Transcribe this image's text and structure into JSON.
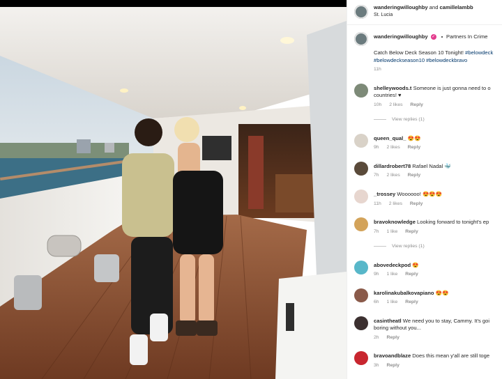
{
  "header": {
    "username": "wanderingwilloughby",
    "conjunction": "and",
    "collaborator": "camillelambb",
    "location": "St. Lucia"
  },
  "caption": {
    "username": "wanderingwilloughby",
    "label": "Partners In Crime",
    "line1_text": "Catch Below Deck Season 10 Tonight! ",
    "line1_tag": "#belowdeck",
    "line2": "#belowdeckseason10 #belowdeckbravo",
    "time": "11h"
  },
  "comments": [
    {
      "username": "shelleywoods.t",
      "text": "Someone is just gonna need to o",
      "text2": "countries! ♥",
      "time": "10h",
      "likes": "2 likes",
      "reply": "Reply",
      "view_replies": "View replies (1)"
    },
    {
      "username": "queen_qual_",
      "text": "😍😍",
      "time": "9h",
      "likes": "2 likes",
      "reply": "Reply"
    },
    {
      "username": "dillardrobert78",
      "text": "Rafael Nadal 🐳",
      "time": "7h",
      "likes": "2 likes",
      "reply": "Reply"
    },
    {
      "username": "_trossey",
      "text": "Woooooo! 😍😍😍",
      "time": "11h",
      "likes": "2 likes",
      "reply": "Reply"
    },
    {
      "username": "bravoknowledge",
      "text": "Looking forward to tonight's ep",
      "time": "7h",
      "likes": "1 like",
      "reply": "Reply",
      "view_replies": "View replies (1)"
    },
    {
      "username": "abovedeckpod",
      "text": "😍",
      "time": "9h",
      "likes": "1 like",
      "reply": "Reply"
    },
    {
      "username": "karolinakubalkovapiano",
      "text": "😍😍",
      "time": "6h",
      "likes": "1 like",
      "reply": "Reply"
    },
    {
      "username": "casintheatl",
      "text": "We need you to stay, Cammy. It's goi",
      "text2": "boring without you...",
      "time": "2h",
      "reply": "Reply"
    },
    {
      "username": "bravoandblaze",
      "text": "Does this mean y'all are still toge",
      "time": "3h",
      "reply": "Reply"
    }
  ],
  "colors": {
    "verified": "#e33b8d",
    "link": "#00376b",
    "meta": "#8e8e8e",
    "deck_wood": "#8a4b2e"
  }
}
